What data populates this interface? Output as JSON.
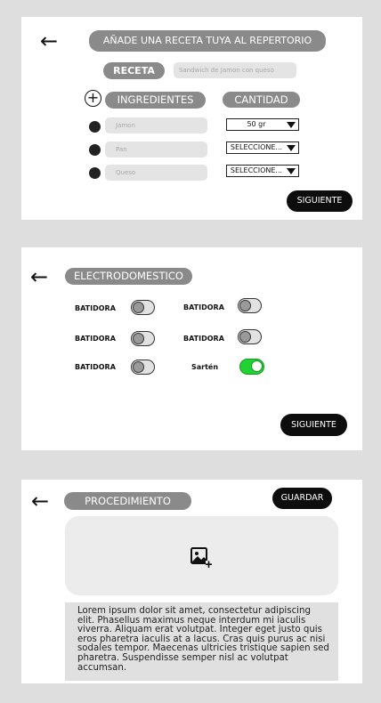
{
  "screen1": {
    "title": "AÑADE UNA RECETA TUYA AL REPERTORIO",
    "recipe_label": "RECETA",
    "recipe_value": "Sandwich de Jamon con queso",
    "ingredients_label": "INGREDIENTES",
    "quantity_label": "CANTIDAD",
    "ingredients": [
      {
        "name": "Jamon",
        "quantity": "50 gr"
      },
      {
        "name": "Pan",
        "quantity": "SELECCIONE..."
      },
      {
        "name": "Queso",
        "quantity": "SELECCIONE..."
      }
    ],
    "next_label": "SIGUIENTE"
  },
  "screen2": {
    "title": "ELECTRODOMESTICO",
    "appliances": [
      {
        "label": "BATIDORA",
        "on": false
      },
      {
        "label": "BATIDORA",
        "on": false
      },
      {
        "label": "BATIDORA",
        "on": false
      },
      {
        "label": "BATIDORA",
        "on": false
      },
      {
        "label": "BATIDORA",
        "on": false
      },
      {
        "label": "Sartén",
        "on": true
      }
    ],
    "next_label": "SIGUIENTE"
  },
  "screen3": {
    "title": "PROCEDIMIENTO",
    "save_label": "GUARDAR",
    "procedure_text": "Lorem ipsum dolor sit amet, consectetur adipiscing elit. Phasellus maximus neque interdum mi iaculis viverra. Aliquam erat volutpat. Integer eget justo quis eros pharetra iaculis at a lacus. Cras quis purus ac nisi sodales tempor. Maecenas ultricies tristique sapien sed pharetra. Suspendisse semper nisl ac volutpat accumsan."
  },
  "icons": {
    "back": "arrow-left-icon",
    "add": "plus-circle-icon",
    "dropdown": "triangle-down-icon",
    "image_upload": "image-add-icon"
  },
  "colors": {
    "pill_gray": "#8a8a8a",
    "toggle_on": "#20d232",
    "button_dark": "#0d0d0d"
  }
}
